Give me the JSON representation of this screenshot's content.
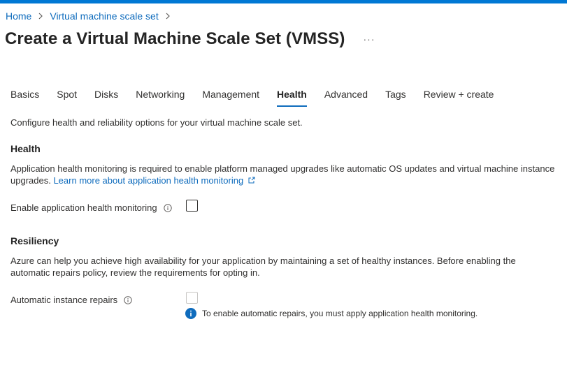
{
  "breadcrumb": {
    "home": "Home",
    "parent": "Virtual machine scale set"
  },
  "page": {
    "title": "Create a Virtual Machine Scale Set (VMSS)",
    "more": "···"
  },
  "tabs": [
    "Basics",
    "Spot",
    "Disks",
    "Networking",
    "Management",
    "Health",
    "Advanced",
    "Tags",
    "Review + create"
  ],
  "active_tab": "Health",
  "intro": "Configure health and reliability options for your virtual machine scale set.",
  "health": {
    "heading": "Health",
    "desc": "Application health monitoring is required to enable platform managed upgrades like automatic OS updates and virtual machine instance upgrades.",
    "link": "Learn more about application health monitoring",
    "enable_label": "Enable application health monitoring",
    "enable_checked": false
  },
  "resiliency": {
    "heading": "Resiliency",
    "desc_line1": "Azure can help you achieve high availability for your application by maintaining a set of healthy instances. Before enabling the",
    "desc_line2": "automatic repairs policy, review the requirements for opting in.",
    "repairs_label": "Automatic instance repairs",
    "repairs_checked": false,
    "repairs_info": "To enable automatic repairs, you must apply application health monitoring."
  },
  "colors": {
    "accent": "#0f6cbd",
    "topbar": "#0078d4",
    "info": "#0f6cbd"
  }
}
